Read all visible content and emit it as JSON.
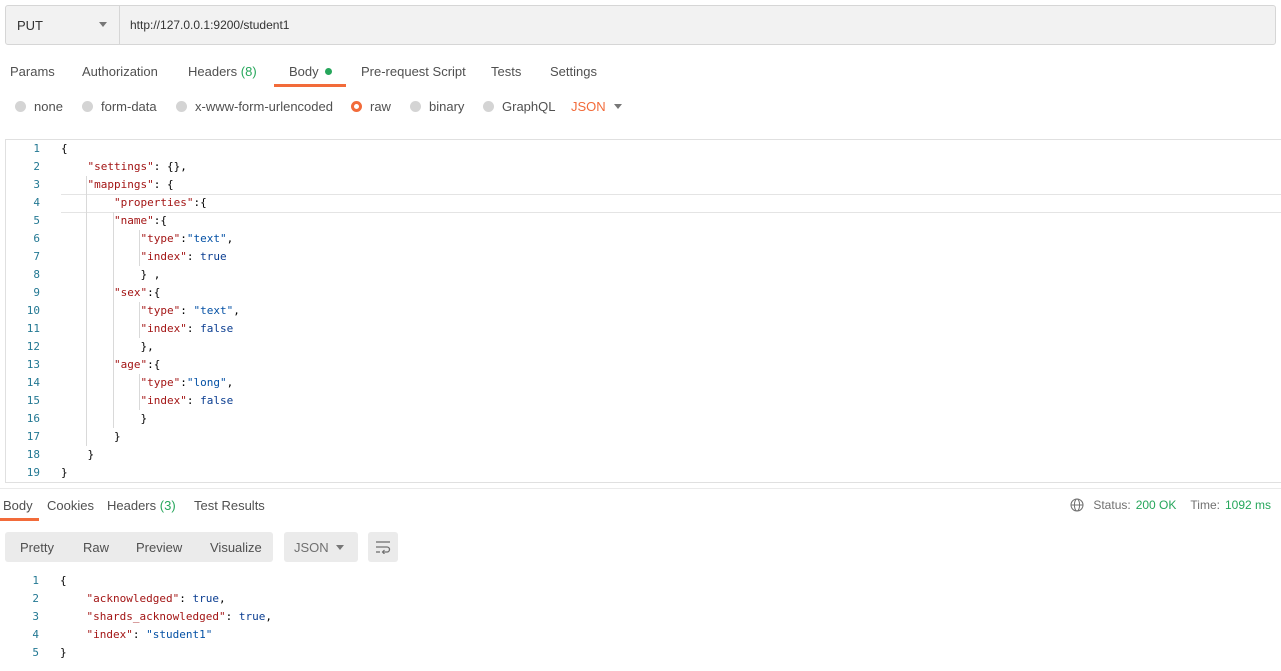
{
  "request": {
    "method": "PUT",
    "url": "http://127.0.0.1:9200/student1"
  },
  "request_tabs": [
    {
      "label": "Params"
    },
    {
      "label": "Authorization"
    },
    {
      "label": "Headers",
      "count": "(8)"
    },
    {
      "label": "Body"
    },
    {
      "label": "Pre-request Script"
    },
    {
      "label": "Tests"
    },
    {
      "label": "Settings"
    }
  ],
  "body_types": [
    {
      "label": "none",
      "selected": false
    },
    {
      "label": "form-data",
      "selected": false
    },
    {
      "label": "x-www-form-urlencoded",
      "selected": false
    },
    {
      "label": "raw",
      "selected": true
    },
    {
      "label": "binary",
      "selected": false
    },
    {
      "label": "GraphQL",
      "selected": false
    }
  ],
  "raw_format": "JSON",
  "request_body_lines": [
    "{",
    "    \"settings\": {},",
    "    \"mappings\": {",
    "        \"properties\":{",
    "        \"name\":{",
    "            \"type\":\"text\",",
    "            \"index\": true",
    "            } ,",
    "        \"sex\":{",
    "            \"type\": \"text\",",
    "            \"index\": false",
    "            },",
    "        \"age\":{",
    "            \"type\":\"long\",",
    "            \"index\": false",
    "            }",
    "        }",
    "    }",
    "}"
  ],
  "response_tabs": [
    {
      "label": "Body"
    },
    {
      "label": "Cookies"
    },
    {
      "label": "Headers",
      "count": "(3)"
    },
    {
      "label": "Test Results"
    }
  ],
  "response_status": {
    "status_label": "Status:",
    "status_value": "200 OK",
    "time_label": "Time:",
    "time_value": "1092 ms"
  },
  "view_modes": [
    "Pretty",
    "Raw",
    "Preview",
    "Visualize"
  ],
  "response_format": "JSON",
  "response_body_lines": [
    "{",
    "    \"acknowledged\": true,",
    "    \"shards_acknowledged\": true,",
    "    \"index\": \"student1\"",
    "}"
  ],
  "colors": {
    "accent": "#f26b3a",
    "success": "#26a65b",
    "key": "#a31515",
    "string": "#0451a5",
    "line_number": "#237893"
  }
}
